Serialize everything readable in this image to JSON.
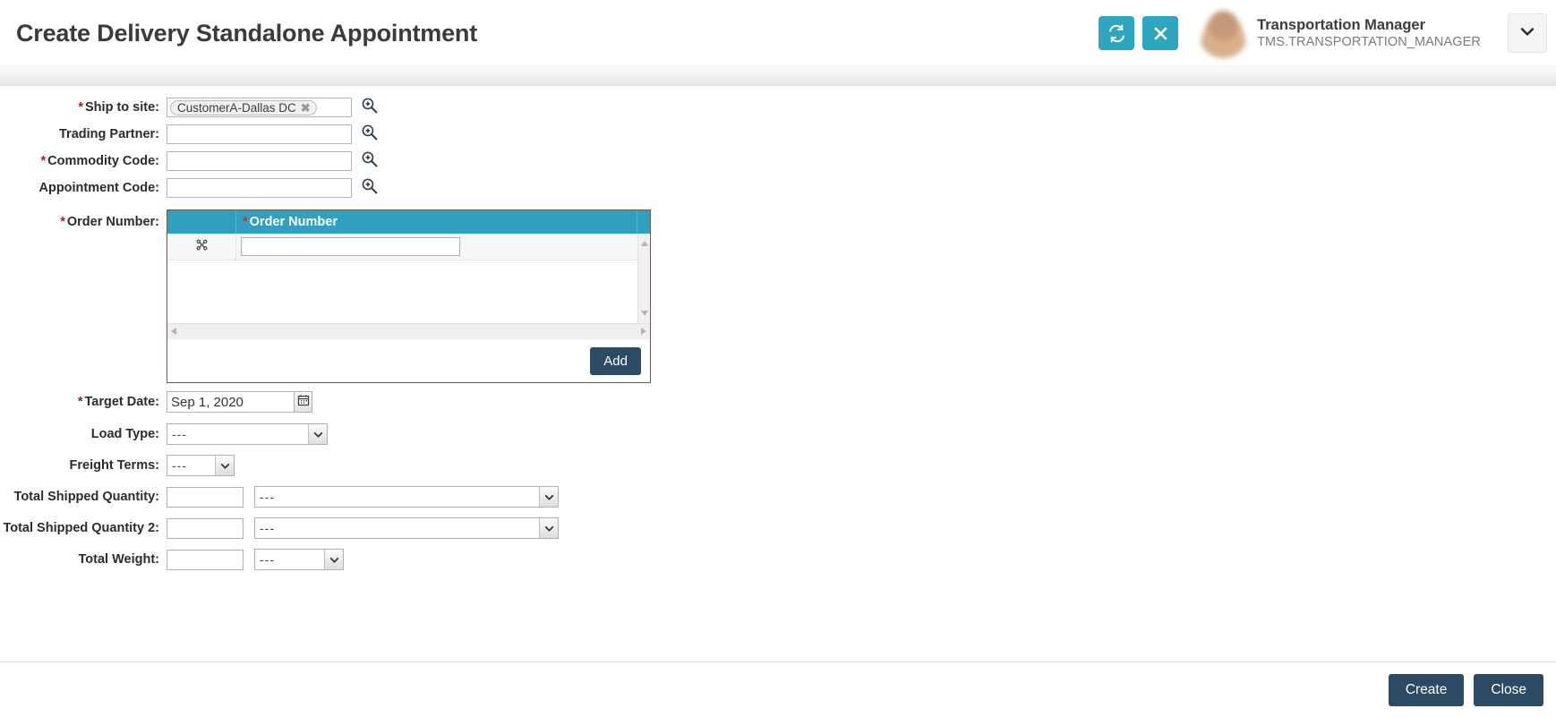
{
  "header": {
    "title": "Create Delivery Standalone Appointment",
    "refresh_icon": "refresh-icon",
    "close_icon": "close-icon",
    "user_name": "Transportation Manager",
    "user_login": "TMS.TRANSPORTATION_MANAGER",
    "chevron_icon": "chevron-down-icon",
    "accent_color": "#2fa5c0"
  },
  "form": {
    "ship_to_site": {
      "label": "Ship to site:",
      "required": true,
      "chip": "CustomerA-Dallas DC",
      "chip_remove": "✖",
      "lookup_icon": "search-lookup-icon"
    },
    "trading_partner": {
      "label": "Trading Partner:",
      "required": false,
      "value": "",
      "lookup_icon": "search-lookup-icon"
    },
    "commodity_code": {
      "label": "Commodity Code:",
      "required": true,
      "value": "",
      "lookup_icon": "search-lookup-icon"
    },
    "appointment_code": {
      "label": "Appointment Code:",
      "required": false,
      "value": "",
      "lookup_icon": "search-lookup-icon"
    },
    "order_number": {
      "label": "Order Number:",
      "required": true,
      "column_header": "Order Number",
      "column_required": true,
      "rows": [
        {
          "delete_icon": "scissors-delete-icon",
          "value": ""
        }
      ],
      "add_button": "Add",
      "header_color": "#2fa0bd"
    },
    "target_date": {
      "label": "Target Date:",
      "required": true,
      "value": "Sep 1, 2020",
      "calendar_icon": "calendar-icon"
    },
    "load_type": {
      "label": "Load Type:",
      "required": false,
      "value": "---"
    },
    "freight_terms": {
      "label": "Freight Terms:",
      "required": false,
      "value": "---"
    },
    "total_shipped_quantity": {
      "label": "Total Shipped Quantity:",
      "required": false,
      "value": "",
      "uom": "---"
    },
    "total_shipped_quantity_2": {
      "label": "Total Shipped Quantity 2:",
      "required": false,
      "value": "",
      "uom": "---"
    },
    "total_weight": {
      "label": "Total Weight:",
      "required": false,
      "value": "",
      "uom": "---"
    }
  },
  "footer": {
    "create_label": "Create",
    "close_label": "Close",
    "button_color": "#2c4a63"
  }
}
